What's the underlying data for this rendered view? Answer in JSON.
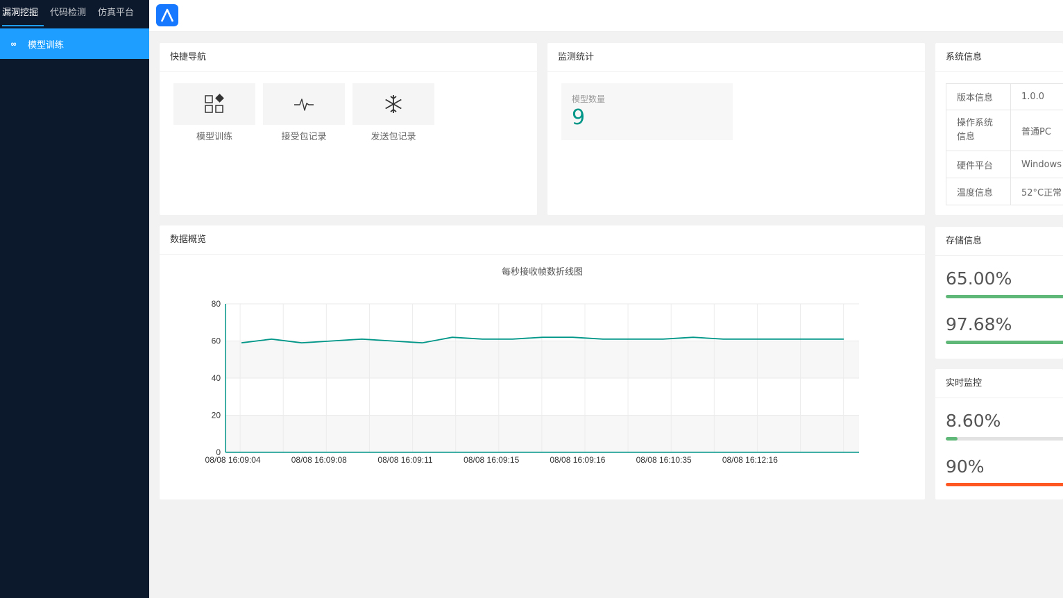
{
  "sidebar": {
    "top_tabs": [
      "漏洞挖掘",
      "代码检测",
      "仿真平台"
    ],
    "menu_items": [
      {
        "label": "模型训练",
        "icon": "link-icon"
      }
    ]
  },
  "quick_nav": {
    "title": "快捷导航",
    "items": [
      {
        "label": "模型训练",
        "icon": "apps-icon"
      },
      {
        "label": "接受包记录",
        "icon": "pulse-icon"
      },
      {
        "label": "发送包记录",
        "icon": "snowflake-icon"
      }
    ]
  },
  "monitor": {
    "title": "监测统计",
    "stat_label": "模型数量",
    "stat_value": "9"
  },
  "system_info": {
    "title": "系统信息",
    "rows": [
      {
        "key": "版本信息",
        "value": "1.0.0"
      },
      {
        "key": "操作系统信息",
        "value": "普通PC"
      },
      {
        "key": "硬件平台",
        "value": "Windows"
      },
      {
        "key": "温度信息",
        "value": "52°C正常"
      }
    ]
  },
  "storage": {
    "title": "存储信息",
    "items": [
      {
        "text": "65.00%",
        "percent": 100,
        "color": "#5fb878"
      },
      {
        "text": "97.68%",
        "percent": 100,
        "color": "#5fb878"
      }
    ]
  },
  "realtime": {
    "title": "实时监控",
    "items": [
      {
        "text": "8.60%",
        "percent": 8.6,
        "color": "#5fb878"
      },
      {
        "text": "90%",
        "percent": 100,
        "color": "#ff5722"
      }
    ]
  },
  "overview": {
    "title": "数据概览"
  },
  "chart_data": {
    "type": "line",
    "title": "每秒接收帧数折线图",
    "categories": [
      "08/08 16:09:04",
      "",
      "08/08 16:09:08",
      "",
      "08/08 16:09:11",
      "",
      "08/08 16:09:15",
      "",
      "08/08 16:09:16",
      "",
      "08/08 16:10:35",
      "",
      "08/08 16:12:16",
      "",
      ""
    ],
    "x_tick_labels": [
      "08/08 16:09:04",
      "08/08 16:09:08",
      "08/08 16:09:11",
      "08/08 16:09:15",
      "08/08 16:09:16",
      "08/08 16:10:35",
      "08/08 16:12:16"
    ],
    "values": [
      59,
      61,
      59,
      60,
      61,
      60,
      59,
      62,
      61,
      61,
      62,
      62,
      61,
      61,
      61,
      62,
      61,
      61,
      61,
      61,
      61
    ],
    "ylim": [
      0,
      80
    ],
    "yticks": [
      0,
      20,
      40,
      60,
      80
    ],
    "color": "#009688",
    "grid": true
  }
}
